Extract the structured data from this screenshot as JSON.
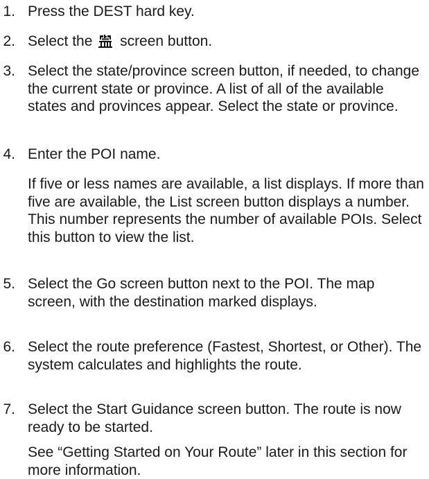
{
  "steps": [
    {
      "number": "1.",
      "text": "Press the DEST hard key."
    },
    {
      "number": "2.",
      "text_before": "Select the",
      "icon": "poi-landmark-icon",
      "text_after": "screen button."
    },
    {
      "number": "3.",
      "text": "Select the state/province screen button, if needed, to change the current state or province. A list of all of the available states and provinces appear. Select the state or province."
    },
    {
      "number": "4.",
      "text": "Enter the POI name.",
      "note": "If five or less names are available, a list displays. If more than five are available, the List screen button displays a number. This number represents the number of available POIs. Select this button to view the list."
    },
    {
      "number": "5.",
      "text": "Select the Go screen button next to the POI. The map screen, with the destination marked displays."
    },
    {
      "number": "6.",
      "text": "Select the route preference (Fastest, Shortest, or Other). The system calculates and highlights the route."
    },
    {
      "number": "7.",
      "text": "Select the Start Guidance screen button. The route is now ready to be started.",
      "note": "See “Getting Started on Your Route” later in this section for more information."
    }
  ]
}
